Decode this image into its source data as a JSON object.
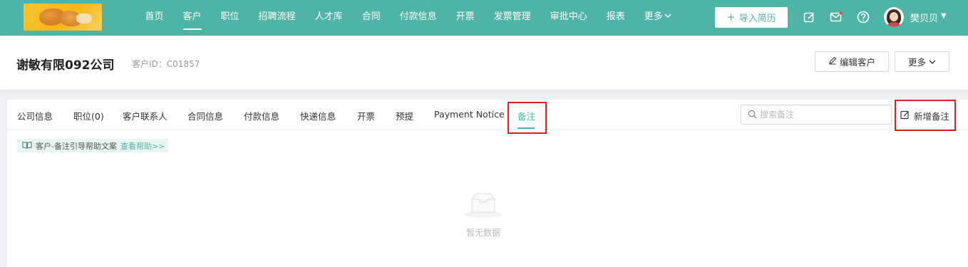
{
  "nav": {
    "items": [
      {
        "label": "首页",
        "active": false
      },
      {
        "label": "客户",
        "active": true
      },
      {
        "label": "职位",
        "active": false
      },
      {
        "label": "招聘流程",
        "active": false
      },
      {
        "label": "人才库",
        "active": false
      },
      {
        "label": "合同",
        "active": false
      },
      {
        "label": "付款信息",
        "active": false
      },
      {
        "label": "开票",
        "active": false
      },
      {
        "label": "发票管理",
        "active": false
      },
      {
        "label": "审批中心",
        "active": false
      },
      {
        "label": "报表",
        "active": false
      },
      {
        "label": "更多",
        "active": false
      }
    ],
    "import_button": "导入简历",
    "user_name": "樊贝贝",
    "icons": [
      "edit-note-icon",
      "mail-icon",
      "help-circle-icon",
      "user-avatar",
      "caret-down-icon"
    ],
    "accent_color": "#4fb3a5"
  },
  "header": {
    "company_name": "谢敏有限092公司",
    "customer_id": "客户ID：C01857",
    "edit_button": "编辑客户",
    "more_button": "更多"
  },
  "tabs": [
    {
      "label": "公司信息",
      "active": false
    },
    {
      "label": "职位(0)",
      "active": false
    },
    {
      "label": "客户联系人",
      "active": false
    },
    {
      "label": "合同信息",
      "active": false
    },
    {
      "label": "付款信息",
      "active": false
    },
    {
      "label": "快递信息",
      "active": false
    },
    {
      "label": "开票",
      "active": false
    },
    {
      "label": "预提",
      "active": false
    },
    {
      "label": "Payment Notice",
      "active": false
    },
    {
      "label": "备注",
      "active": true
    }
  ],
  "search": {
    "placeholder": "搜索备注",
    "value": ""
  },
  "add_note_button": "新增备注",
  "help": {
    "text": "客户-备注引导帮助文案",
    "link": "查看帮助>>"
  },
  "empty_state": "暂无数据"
}
